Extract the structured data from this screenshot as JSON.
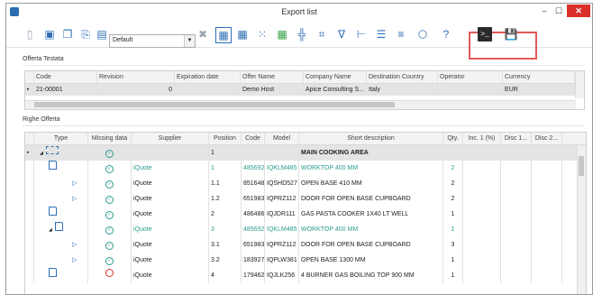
{
  "window": {
    "title": "Export list"
  },
  "toolbar": {
    "select_value": "Default",
    "icons": [
      "new-doc-icon",
      "save-blue-icon",
      "copy-icon",
      "export-icon",
      "select-dropdown",
      "remove-icon",
      "grid-icon",
      "grid-alt-icon",
      "grid-dots-icon",
      "grid-green-icon",
      "split-icon",
      "code-icon",
      "filter-icon",
      "tree-icon",
      "align-icon",
      "align-center-icon",
      "package-icon",
      "help-icon",
      "terminal-icon",
      "save-export-icon"
    ]
  },
  "offerta": {
    "label": "Offerta Testata",
    "headers": [
      "Code",
      "Revision",
      "Expiration date",
      "Offer Name",
      "Company Name",
      "Destination Country",
      "Operator",
      "Currency"
    ],
    "row": [
      "21-00001",
      "0",
      "",
      "Demo Host",
      "Apice Consulting S...",
      "Italy",
      "",
      "EUR"
    ]
  },
  "righe": {
    "label": "Righe Offerta",
    "headers": [
      "Type",
      "Missing data",
      "Supplier",
      "Position",
      "Code",
      "Model",
      "Short description",
      "Qty.",
      "Inc. 1 (%)",
      "Disc 1...",
      "Disc 2..."
    ],
    "rows": [
      {
        "supplier": "",
        "pos": "1",
        "code": "",
        "model": "",
        "desc": "MAIN COOKING AREA",
        "qty": "",
        "style": "bold",
        "level": 0
      },
      {
        "supplier": "iQuote",
        "pos": "1",
        "code": "485692",
        "model": "IQKLM485",
        "desc": "WORKTOP 400 MM",
        "qty": "2",
        "style": "link",
        "level": 1
      },
      {
        "supplier": "iQuote",
        "pos": "1.1",
        "code": "851648",
        "model": "IQSHD527",
        "desc": "OPEN BASE 410 MM",
        "qty": "2",
        "style": "",
        "level": 2
      },
      {
        "supplier": "iQuote",
        "pos": "1.2",
        "code": "651983",
        "model": "IQPRZ112",
        "desc": "DOOR FOR OPEN BASE CUPBOARD",
        "qty": "2",
        "style": "",
        "level": 2
      },
      {
        "supplier": "iQuote",
        "pos": "2",
        "code": "486486",
        "model": "IQJDR111",
        "desc": "GAS PASTA COOKER 1X40 LT WELL",
        "qty": "1",
        "style": "",
        "level": 1
      },
      {
        "supplier": "iQuote",
        "pos": "3",
        "code": "485692",
        "model": "IQKLM485",
        "desc": "WORKTOP 400 MM",
        "qty": "1",
        "style": "link",
        "level": 1
      },
      {
        "supplier": "iQuote",
        "pos": "3.1",
        "code": "651983",
        "model": "IQPRZ112",
        "desc": "DOOR FOR OPEN BASE CUPBOARD",
        "qty": "3",
        "style": "",
        "level": 2
      },
      {
        "supplier": "iQuote",
        "pos": "3.2",
        "code": "183927",
        "model": "IQPLW381",
        "desc": "OPEN BASE 1300 MM",
        "qty": "1",
        "style": "",
        "level": 2
      },
      {
        "supplier": "iQuote",
        "pos": "4",
        "code": "179462",
        "model": "IQJLK256",
        "desc": "4 BURNER GAS BOILING TOP 900 MM",
        "qty": "1",
        "style": "",
        "level": 1
      }
    ]
  }
}
